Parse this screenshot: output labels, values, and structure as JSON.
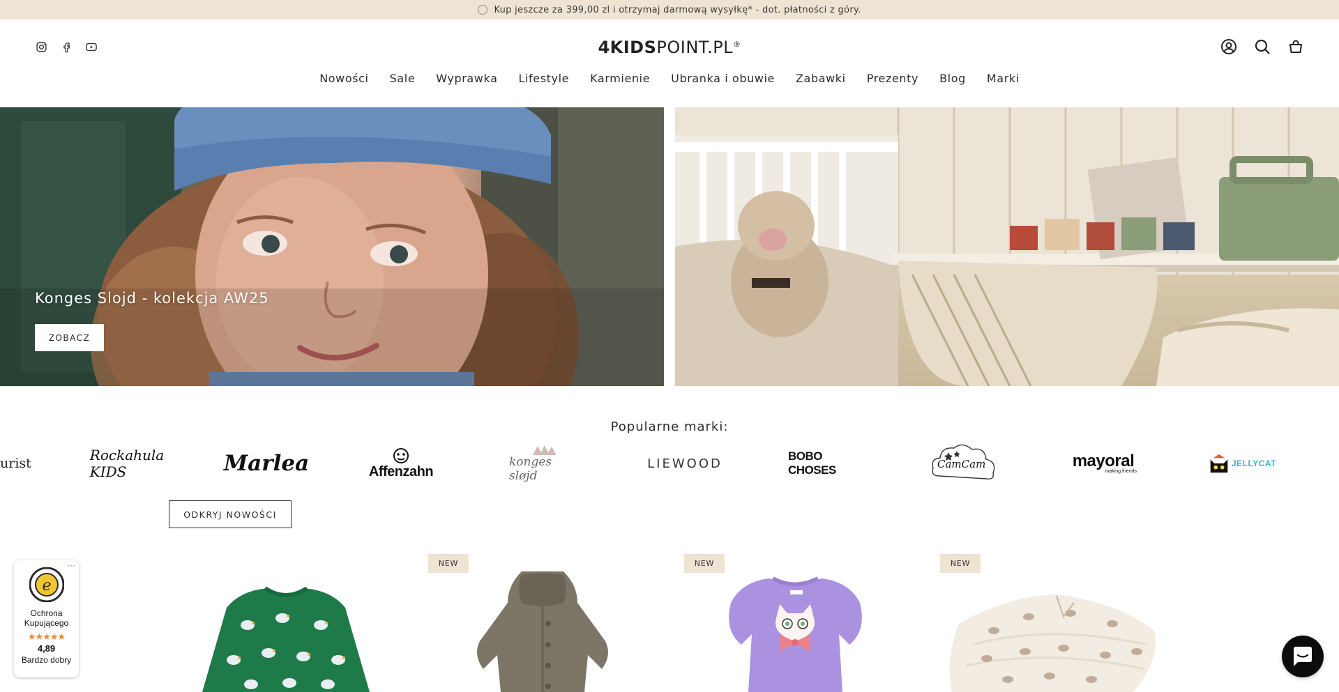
{
  "announcement": {
    "text": "Kup jeszcze za 399,00 zl i otrzymaj darmową wysyłkę* - dot. płatności z góry."
  },
  "header": {
    "logo_bold": "4KIDS",
    "logo_rest": "POINT.PL",
    "logo_reg": "®",
    "social": [
      "instagram-icon",
      "facebook-icon",
      "youtube-icon"
    ],
    "tools": [
      "account-icon",
      "search-icon",
      "cart-icon"
    ]
  },
  "nav": {
    "items": [
      "Nowości",
      "Sale",
      "Wyprawka",
      "Lifestyle",
      "Karmienie",
      "Ubranka i obuwie",
      "Zabawki",
      "Prezenty",
      "Blog",
      "Marki"
    ]
  },
  "hero": {
    "title": "Konges Slojd - kolekcja AW25",
    "button": "ZOBACZ"
  },
  "brands": {
    "title": "Popularne marki:",
    "logos": [
      "urist",
      "Rockahula KIDS",
      "Marlea",
      "Affenzahn",
      "konges sløjd",
      "LIEWOOD",
      "BOBO CHOSES",
      "CamCam",
      "mayoral",
      "making friends",
      "JELLYCAT"
    ],
    "discover_button": "ODKRYJ NOWOŚCI"
  },
  "products": {
    "badge": "NEW"
  },
  "trust": {
    "line1": "Ochrona Kupującego",
    "stars": "★★★★★",
    "score": "4,89",
    "line2": "Bardzo dobry",
    "more": "···"
  },
  "colors": {
    "announce_bg": "#efe3d3",
    "badge_bg": "#efe3d3",
    "chat_bg": "#0c0c0c",
    "stars": "#ea8c32"
  }
}
